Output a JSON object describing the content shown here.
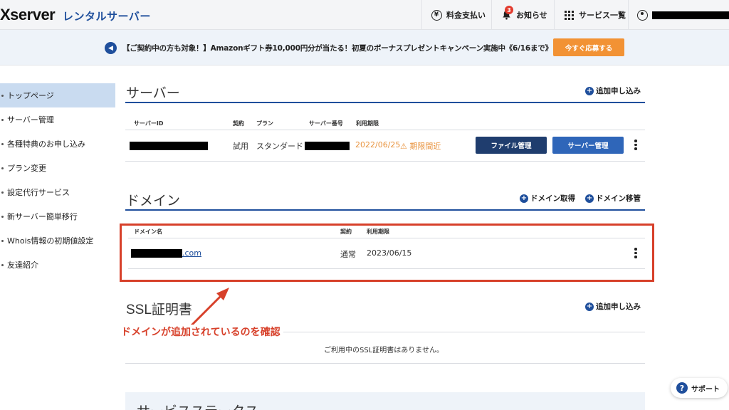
{
  "header": {
    "logo": "Xserver",
    "logo_sub": "レンタルサーバー",
    "billing_label": "料金支払い",
    "billing_icon": "yen-icon",
    "notice_label": "お知らせ",
    "notice_badge": "3",
    "services_label": "サービス一覧",
    "user_icon": "user-icon"
  },
  "banner": {
    "text": "【ご契約中の方も対象！】Amazonギフト券10,000円分が当たる！初夏のボーナスプレゼントキャンペーン実施中《6/16まで》",
    "button": "今すぐ応募する"
  },
  "sidebar": {
    "items": [
      {
        "label": "トップページ",
        "active": true
      },
      {
        "label": "サーバー管理"
      },
      {
        "label": "各種特典のお申し込み"
      },
      {
        "label": "プラン変更"
      },
      {
        "label": "設定代行サービス"
      },
      {
        "label": "新サーバー簡単移行"
      },
      {
        "label": "Whois情報の初期値設定"
      },
      {
        "label": "友達紹介"
      }
    ]
  },
  "server": {
    "title": "サーバー",
    "add_link": "追加申し込み",
    "columns": {
      "id": "サーバーID",
      "contract": "契約",
      "plan": "プラン",
      "number": "サーバー番号",
      "expiry": "利用期限"
    },
    "row": {
      "contract": "試用",
      "plan": "スタンダード",
      "expiry": "2022/06/25",
      "warning": "期限間近",
      "file_button": "ファイル管理",
      "server_button": "サーバー管理"
    }
  },
  "domain": {
    "title": "ドメイン",
    "acquire_link": "ドメイン取得",
    "transfer_link": "ドメイン移管",
    "columns": {
      "name": "ドメイン名",
      "contract": "契約",
      "expiry": "利用期限"
    },
    "row": {
      "name_suffix": ".com",
      "contract": "通常",
      "expiry": "2023/06/15"
    }
  },
  "ssl": {
    "title": "SSL証明書",
    "add_link": "追加申し込み",
    "empty_message": "ご利用中のSSL証明書はありません。"
  },
  "annotation": {
    "text": "ドメインが追加されているのを確認",
    "color": "#d7402a"
  },
  "support": {
    "label": "サポート"
  },
  "bottom": {
    "title": "サービスステータス"
  }
}
